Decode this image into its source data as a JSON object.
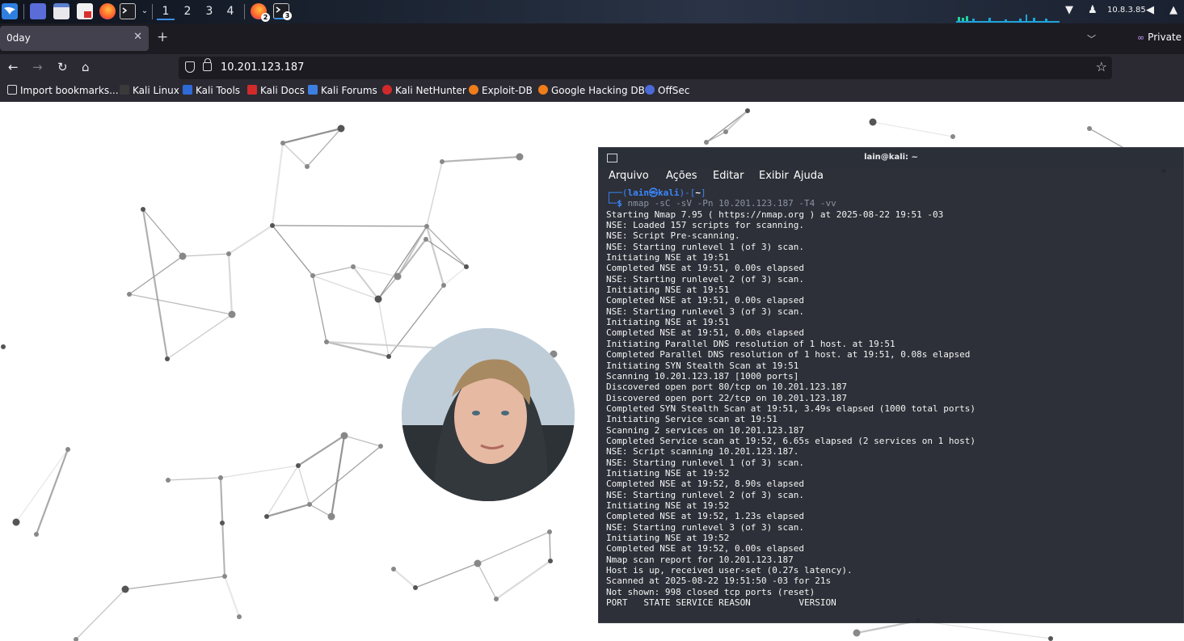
{
  "taskbar": {
    "workspaces": [
      "1",
      "2",
      "3",
      "4"
    ],
    "active_workspace": "1",
    "firefox_badge": "2",
    "terminal_badge": "3",
    "ip_address": "10.8.3.85"
  },
  "browser": {
    "tab_title": "0day",
    "private_label": "Private",
    "url": "10.201.123.187",
    "bookmarks": [
      "Import bookmarks...",
      "Kali Linux",
      "Kali Tools",
      "Kali Docs",
      "Kali Forums",
      "Kali NetHunter",
      "Exploit-DB",
      "Google Hacking DB",
      "OffSec"
    ]
  },
  "terminal": {
    "title": "lain@kali: ~",
    "menu": [
      "Arquivo",
      "Ações",
      "Editar",
      "Exibir",
      "Ajuda"
    ],
    "prompt_user": "lain",
    "prompt_host": "kali",
    "prompt_dir": "~",
    "command": "nmap -sC -sV -Pn 10.201.123.187 -T4 -vv",
    "output": [
      "Starting Nmap 7.95 ( https://nmap.org ) at 2025-08-22 19:51 -03",
      "NSE: Loaded 157 scripts for scanning.",
      "NSE: Script Pre-scanning.",
      "NSE: Starting runlevel 1 (of 3) scan.",
      "Initiating NSE at 19:51",
      "Completed NSE at 19:51, 0.00s elapsed",
      "NSE: Starting runlevel 2 (of 3) scan.",
      "Initiating NSE at 19:51",
      "Completed NSE at 19:51, 0.00s elapsed",
      "NSE: Starting runlevel 3 (of 3) scan.",
      "Initiating NSE at 19:51",
      "Completed NSE at 19:51, 0.00s elapsed",
      "Initiating Parallel DNS resolution of 1 host. at 19:51",
      "Completed Parallel DNS resolution of 1 host. at 19:51, 0.08s elapsed",
      "Initiating SYN Stealth Scan at 19:51",
      "Scanning 10.201.123.187 [1000 ports]",
      "Discovered open port 80/tcp on 10.201.123.187",
      "Discovered open port 22/tcp on 10.201.123.187",
      "Completed SYN Stealth Scan at 19:51, 3.49s elapsed (1000 total ports)",
      "Initiating Service scan at 19:51",
      "Scanning 2 services on 10.201.123.187",
      "Completed Service scan at 19:52, 6.65s elapsed (2 services on 1 host)",
      "NSE: Script scanning 10.201.123.187.",
      "NSE: Starting runlevel 1 (of 3) scan.",
      "Initiating NSE at 19:52",
      "Completed NSE at 19:52, 8.90s elapsed",
      "NSE: Starting runlevel 2 (of 3) scan.",
      "Initiating NSE at 19:52",
      "Completed NSE at 19:52, 1.23s elapsed",
      "NSE: Starting runlevel 3 (of 3) scan.",
      "Initiating NSE at 19:52",
      "Completed NSE at 19:52, 0.00s elapsed",
      "Nmap scan report for 10.201.123.187",
      "Host is up, received user-set (0.27s latency).",
      "Scanned at 2025-08-22 19:51:50 -03 for 21s",
      "Not shown: 998 closed tcp ports (reset)",
      "PORT   STATE SERVICE REASON         VERSION"
    ]
  }
}
